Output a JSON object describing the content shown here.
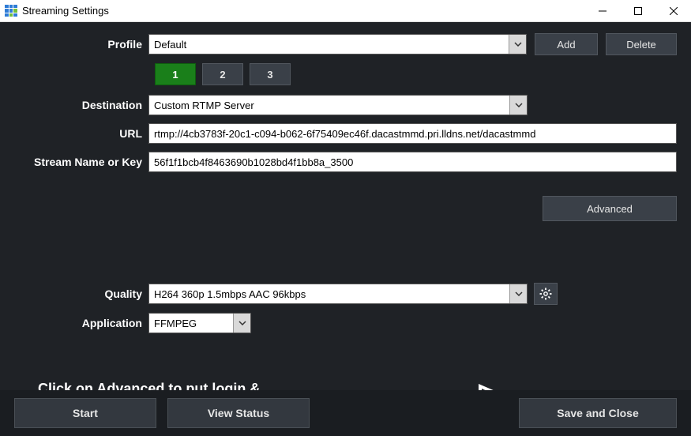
{
  "window": {
    "title": "Streaming Settings"
  },
  "profile": {
    "label": "Profile",
    "selected": "Default",
    "add_label": "Add",
    "delete_label": "Delete"
  },
  "tabs": [
    "1",
    "2",
    "3"
  ],
  "destination": {
    "label": "Destination",
    "selected": "Custom RTMP Server"
  },
  "url": {
    "label": "URL",
    "value": "rtmp://4cb3783f-20c1-c094-b062-6f75409ec46f.dacastmmd.pri.lldns.net/dacastmmd"
  },
  "stream_key": {
    "label": "Stream Name or Key",
    "value": "56f1f1bcb4f8463690b1028bd4f1bb8a_3500"
  },
  "advanced": {
    "button_label": "Advanced"
  },
  "annotation": {
    "text": "Click on Advanced to put login & password."
  },
  "quality": {
    "label": "Quality",
    "selected": "H264 360p 1.5mbps AAC 96kbps"
  },
  "application": {
    "label": "Application",
    "selected": "FFMPEG"
  },
  "footer": {
    "start_label": "Start",
    "view_status_label": "View Status",
    "save_close_label": "Save and Close"
  },
  "icons": {
    "gear": "gear-icon",
    "chevron_down": "chevron-down-icon"
  }
}
